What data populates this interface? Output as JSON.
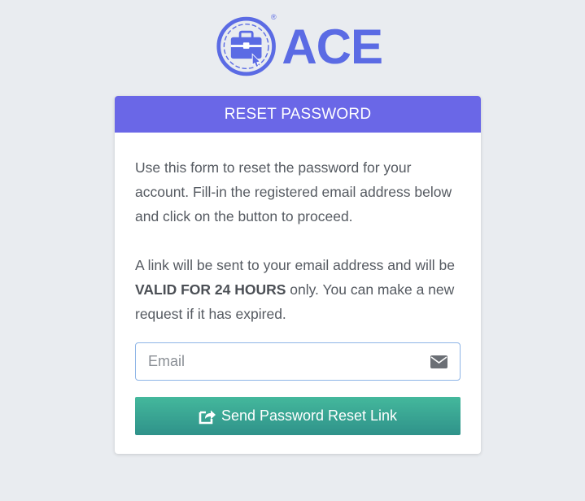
{
  "brand": {
    "name": "ACE",
    "registered_mark": "®",
    "color": "#5b6be4"
  },
  "card": {
    "title": "RESET PASSWORD",
    "header_color": "#6a67e7",
    "intro": "Use this form to reset the password for your account. Fill-in the registered email address below and click on the button to proceed.",
    "notice_before": "A link will be sent to your email address and will be ",
    "notice_emphasis": "VALID FOR 24 HOURS",
    "notice_after": " only. You can make a new request if it has expired."
  },
  "form": {
    "email_placeholder": "Email",
    "email_value": "",
    "email_icon": "envelope-icon",
    "submit_label": "Send Password Reset Link",
    "submit_icon": "share-square-icon",
    "submit_color": "#36a592"
  }
}
